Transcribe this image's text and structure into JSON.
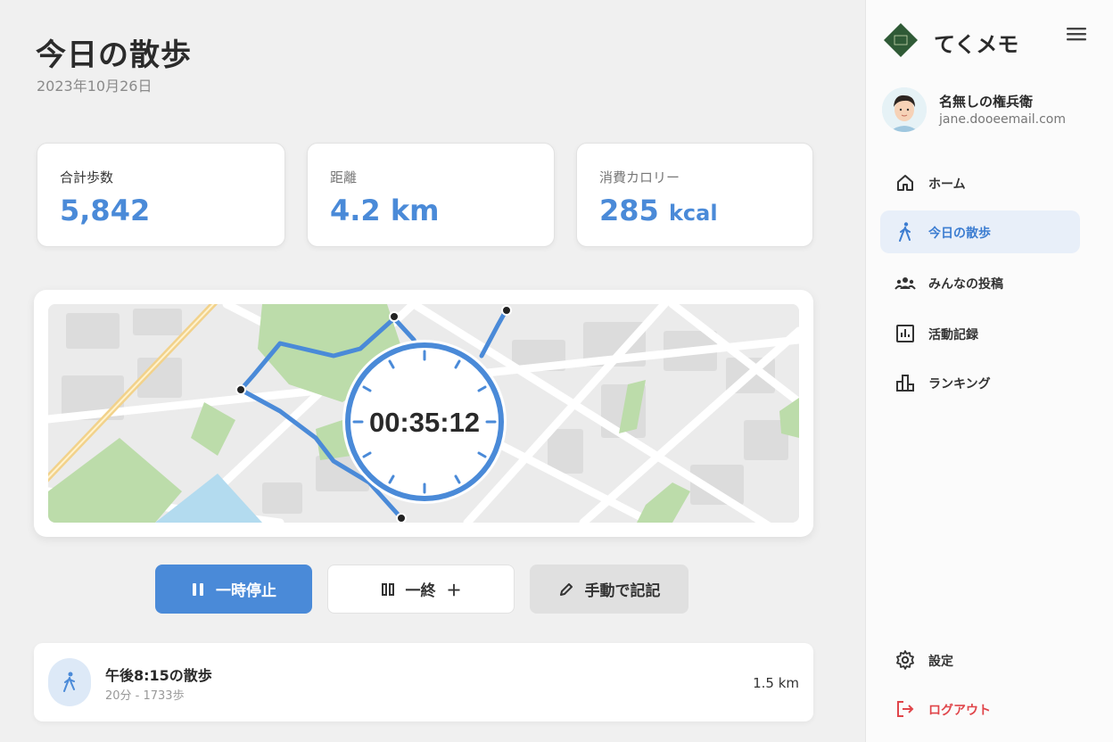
{
  "page": {
    "title": "今日の散歩",
    "date": "2023年10月26日"
  },
  "stats": [
    {
      "label": "合計歩数",
      "value": "5,842",
      "unit": ""
    },
    {
      "label": "距離",
      "value": "4.2",
      "unit": "km"
    },
    {
      "label": "消費カロリー",
      "value": "285",
      "unit": "kcal"
    }
  ],
  "timer": {
    "elapsed": "00:35:12"
  },
  "controls": {
    "pause_label": "一時停止",
    "end_label": "一終",
    "end_plus": "＋",
    "manual_label": "手動で記記"
  },
  "history": {
    "title": "午後8:15の散歩",
    "subtitle": "20分 - 1733歩",
    "distance": "1.5 km"
  },
  "sidebar": {
    "app_name": "てくメモ",
    "user": {
      "name": "名無しの権兵衛",
      "email": "jane.dooeemail.com"
    },
    "nav": [
      {
        "label": "ホーム",
        "icon": "home-icon"
      },
      {
        "label": "今日の散歩",
        "icon": "walk-icon",
        "active": true
      },
      {
        "label": "みんなの投稿",
        "icon": "group-icon"
      },
      {
        "label": "活動記録",
        "icon": "chart-icon"
      },
      {
        "label": "ランキング",
        "icon": "ranking-icon"
      }
    ],
    "settings_label": "設定",
    "logout_label": "ログアウト"
  },
  "colors": {
    "accent": "#4a8ad8",
    "logout": "#e0454a",
    "map_route": "#4a8ad8"
  }
}
